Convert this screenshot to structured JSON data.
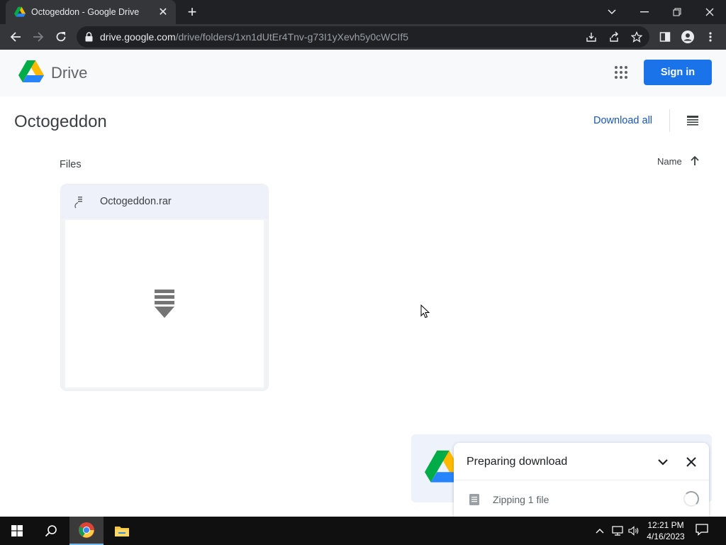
{
  "browser": {
    "tab_title": "Octogeddon - Google Drive",
    "url_host": "drive.google.com",
    "url_path": "/drive/folders/1xn1dUtEr4Tnv-g73I1yXevh5y0cWCIf5",
    "icons": [
      "back-icon",
      "forward-icon",
      "reload-icon",
      "lock-icon",
      "install-icon",
      "share-icon",
      "bookmark-star-icon",
      "side-panel-icon",
      "profile-icon",
      "menu-icon",
      "chevron-down-icon",
      "minimize-icon",
      "restore-icon",
      "close-icon"
    ]
  },
  "drive": {
    "brand": "Drive",
    "signin_label": "Sign in",
    "folder_title": "Octogeddon",
    "download_all_label": "Download all",
    "files_label": "Files",
    "sort_label": "Name",
    "files": [
      {
        "name": "Octogeddon.rar",
        "icon": "archive-icon"
      }
    ],
    "accent_color": "#1a73e8"
  },
  "download_popup": {
    "title": "Preparing download",
    "status": "Zipping 1 file"
  },
  "taskbar": {
    "time": "12:21 PM",
    "date": "4/16/2023",
    "apps": [
      "start-icon",
      "search-icon",
      "chrome-icon",
      "file-explorer-icon"
    ]
  }
}
